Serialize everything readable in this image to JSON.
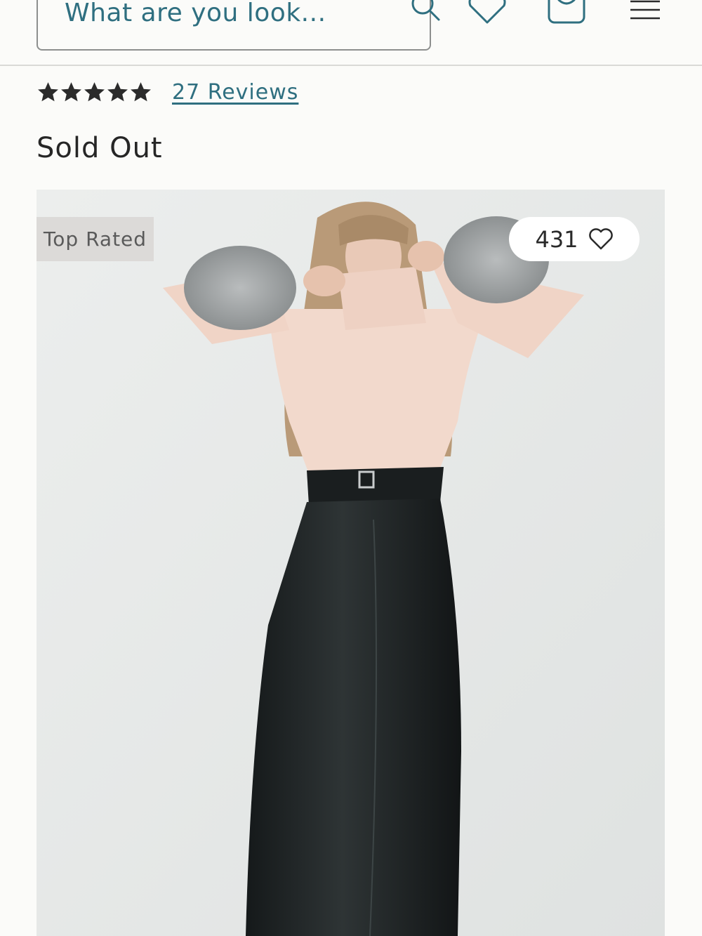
{
  "header": {
    "search_placeholder": "What are you look...",
    "icons": [
      "search-icon",
      "wishlist-heart-icon",
      "shopping-bag-icon",
      "hamburger-menu-icon"
    ]
  },
  "product": {
    "rating": 5,
    "rating_max": 5,
    "reviews_label": "27 Reviews",
    "availability": "Sold Out",
    "image": {
      "badge": "Top Rated",
      "likes": "431"
    }
  },
  "colors": {
    "accent": "#2f6f80",
    "background": "#fbfbf9",
    "badge_bg": "#dcdad8"
  }
}
